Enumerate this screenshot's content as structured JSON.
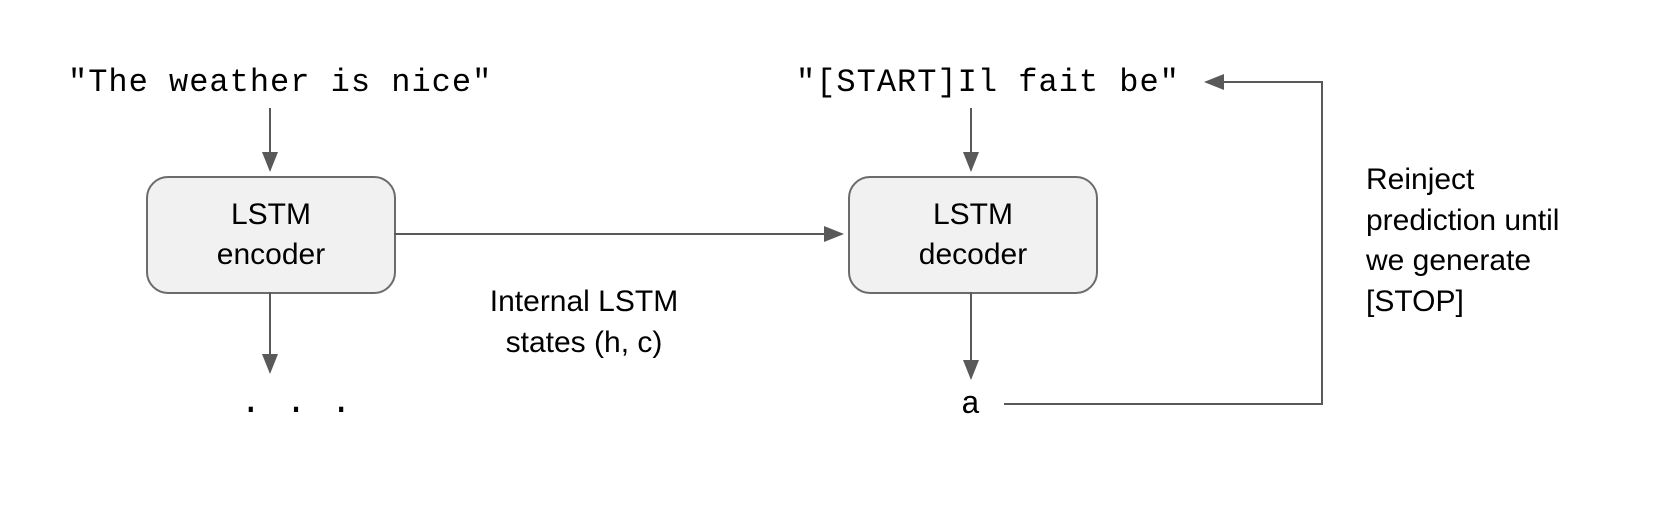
{
  "encoder_input": "\"The weather is nice\"",
  "decoder_input": "\"[START]Il fait be\"",
  "encoder_box": "LSTM\nencoder",
  "decoder_box": "LSTM\ndecoder",
  "internal_states_label": "Internal LSTM\nstates (h, c)",
  "reinject_label": "Reinject\nprediction until\nwe generate\n[STOP]",
  "encoder_output": ". . .",
  "decoder_output": "a"
}
